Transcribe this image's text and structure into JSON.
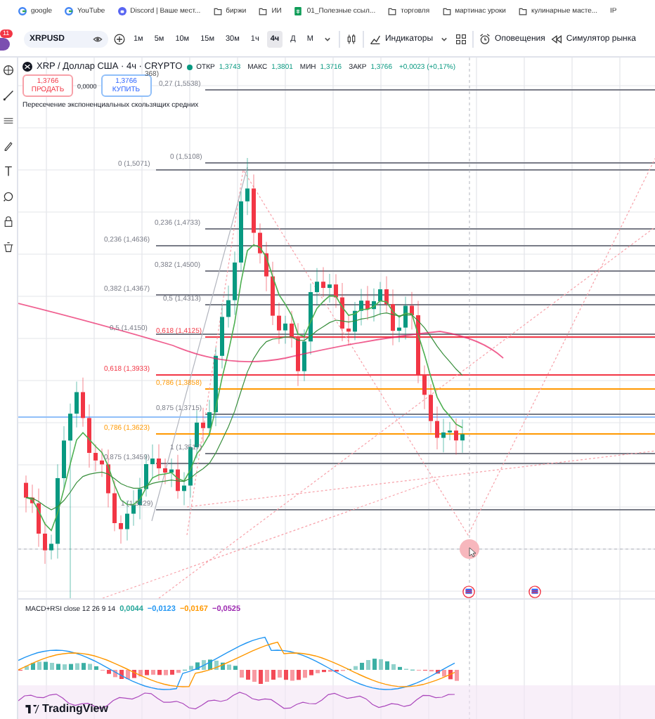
{
  "bookmarks": [
    {
      "label": "google",
      "kind": "google"
    },
    {
      "label": "YouTube",
      "kind": "google"
    },
    {
      "label": "Discord | Ваше мест...",
      "kind": "discord"
    },
    {
      "label": "биржи",
      "kind": "folder"
    },
    {
      "label": "ИИ",
      "kind": "folder"
    },
    {
      "label": "01_Полезные ссыл...",
      "kind": "sheet"
    },
    {
      "label": "торговля",
      "kind": "folder"
    },
    {
      "label": "мартинас уроки",
      "kind": "folder"
    },
    {
      "label": "кулинарные масте...",
      "kind": "folder"
    },
    {
      "label": "IP",
      "kind": "none"
    }
  ],
  "toolbar": {
    "notification_count": "11",
    "symbol": "XRPUSD",
    "intervals": [
      {
        "label": "1м",
        "selected": false
      },
      {
        "label": "5м",
        "selected": false
      },
      {
        "label": "10м",
        "selected": false
      },
      {
        "label": "15м",
        "selected": false
      },
      {
        "label": "30м",
        "selected": false
      },
      {
        "label": "1ч",
        "selected": false
      },
      {
        "label": "4ч",
        "selected": true
      },
      {
        "label": "Д",
        "selected": false
      },
      {
        "label": "М",
        "selected": false
      }
    ],
    "indicators": "Индикаторы",
    "alerts": "Оповещения",
    "replay": "Симулятор рынка"
  },
  "chart": {
    "title": "XRP / Доллар США · 4ч · CRYPTO",
    "ohlc": [
      {
        "label": "ОТКР",
        "value": "1,3743"
      },
      {
        "label": "МАКС",
        "value": "1,3801"
      },
      {
        "label": "МИН",
        "value": "1,3716"
      },
      {
        "label": "ЗАКР",
        "value": "1,3766"
      }
    ],
    "change": "+0,0023 (+0,17%)",
    "sell": {
      "price": "1,3766",
      "label": "ПРОДАТЬ"
    },
    "spread": "0,0000",
    "buy": {
      "price": "1,3766",
      "label": "КУПИТЬ"
    },
    "partial_label": "368)",
    "indicator": "Пересечение экспоненциальных скользящих средних",
    "fib_levels": [
      {
        "label": "0,27 (1,5538)",
        "color": "#787b86"
      },
      {
        "label": "0 (1,5108)",
        "color": "#787b86"
      },
      {
        "label": "0 (1,5071)",
        "color": "#787b86"
      },
      {
        "label": "0,236 (1,4733)",
        "color": "#787b86"
      },
      {
        "label": "0,236 (1,4636)",
        "color": "#787b86"
      },
      {
        "label": "0,382 (1,4500)",
        "color": "#787b86"
      },
      {
        "label": "0,382 (1,4367)",
        "color": "#787b86"
      },
      {
        "label": "0,5 (1,4313)",
        "color": "#787b86"
      },
      {
        "label": "0,5 (1,4150)",
        "color": "#787b86"
      },
      {
        "label": "0,618 (1,4125)",
        "color": "#f23645"
      },
      {
        "label": "0,618 (1,3933)",
        "color": "#f23645"
      },
      {
        "label": "0,786 (1,3858)",
        "color": "#ff9800"
      },
      {
        "label": "0,875 (1,3715)",
        "color": "#787b86"
      },
      {
        "label": "0,786 (1,3623)",
        "color": "#ff9800"
      },
      {
        "label": "1 (1,3517)",
        "color": "#787b86"
      },
      {
        "label": "0,875 (1,3459)",
        "color": "#787b86"
      },
      {
        "label": "1 (1,3229)",
        "color": "#787b86"
      }
    ]
  },
  "macd": {
    "title": "MACD+RSI close 12 26 9 14",
    "values": [
      {
        "text": "0,0044",
        "color": "#26a69a"
      },
      {
        "text": "−0,0123",
        "color": "#2196f3"
      },
      {
        "text": "−0,0167",
        "color": "#ff9800"
      },
      {
        "text": "−0,0525",
        "color": "#9c27b0"
      }
    ]
  },
  "logo": "TradingView"
}
